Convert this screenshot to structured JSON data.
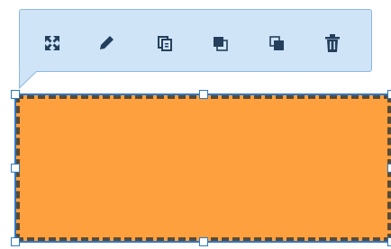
{
  "colors": {
    "toolbar_bg": "#cfe4f7",
    "toolbar_border": "#8db7e0",
    "icon": "#243f5c",
    "shape_fill": "#ffa03f",
    "shape_border": "#5a4a35",
    "selection": "#2f78c4"
  },
  "toolbar": {
    "buttons": [
      {
        "name": "expand-icon",
        "action": "fullscreen"
      },
      {
        "name": "pencil-icon",
        "action": "edit"
      },
      {
        "name": "copy-icon",
        "action": "duplicate"
      },
      {
        "name": "bring-to-front-icon",
        "action": "bring-to-front"
      },
      {
        "name": "send-to-back-icon",
        "action": "send-to-back"
      },
      {
        "name": "trash-icon",
        "action": "delete"
      }
    ]
  },
  "shape": {
    "kind": "rectangle",
    "border_style": "dashed",
    "selected": true
  }
}
